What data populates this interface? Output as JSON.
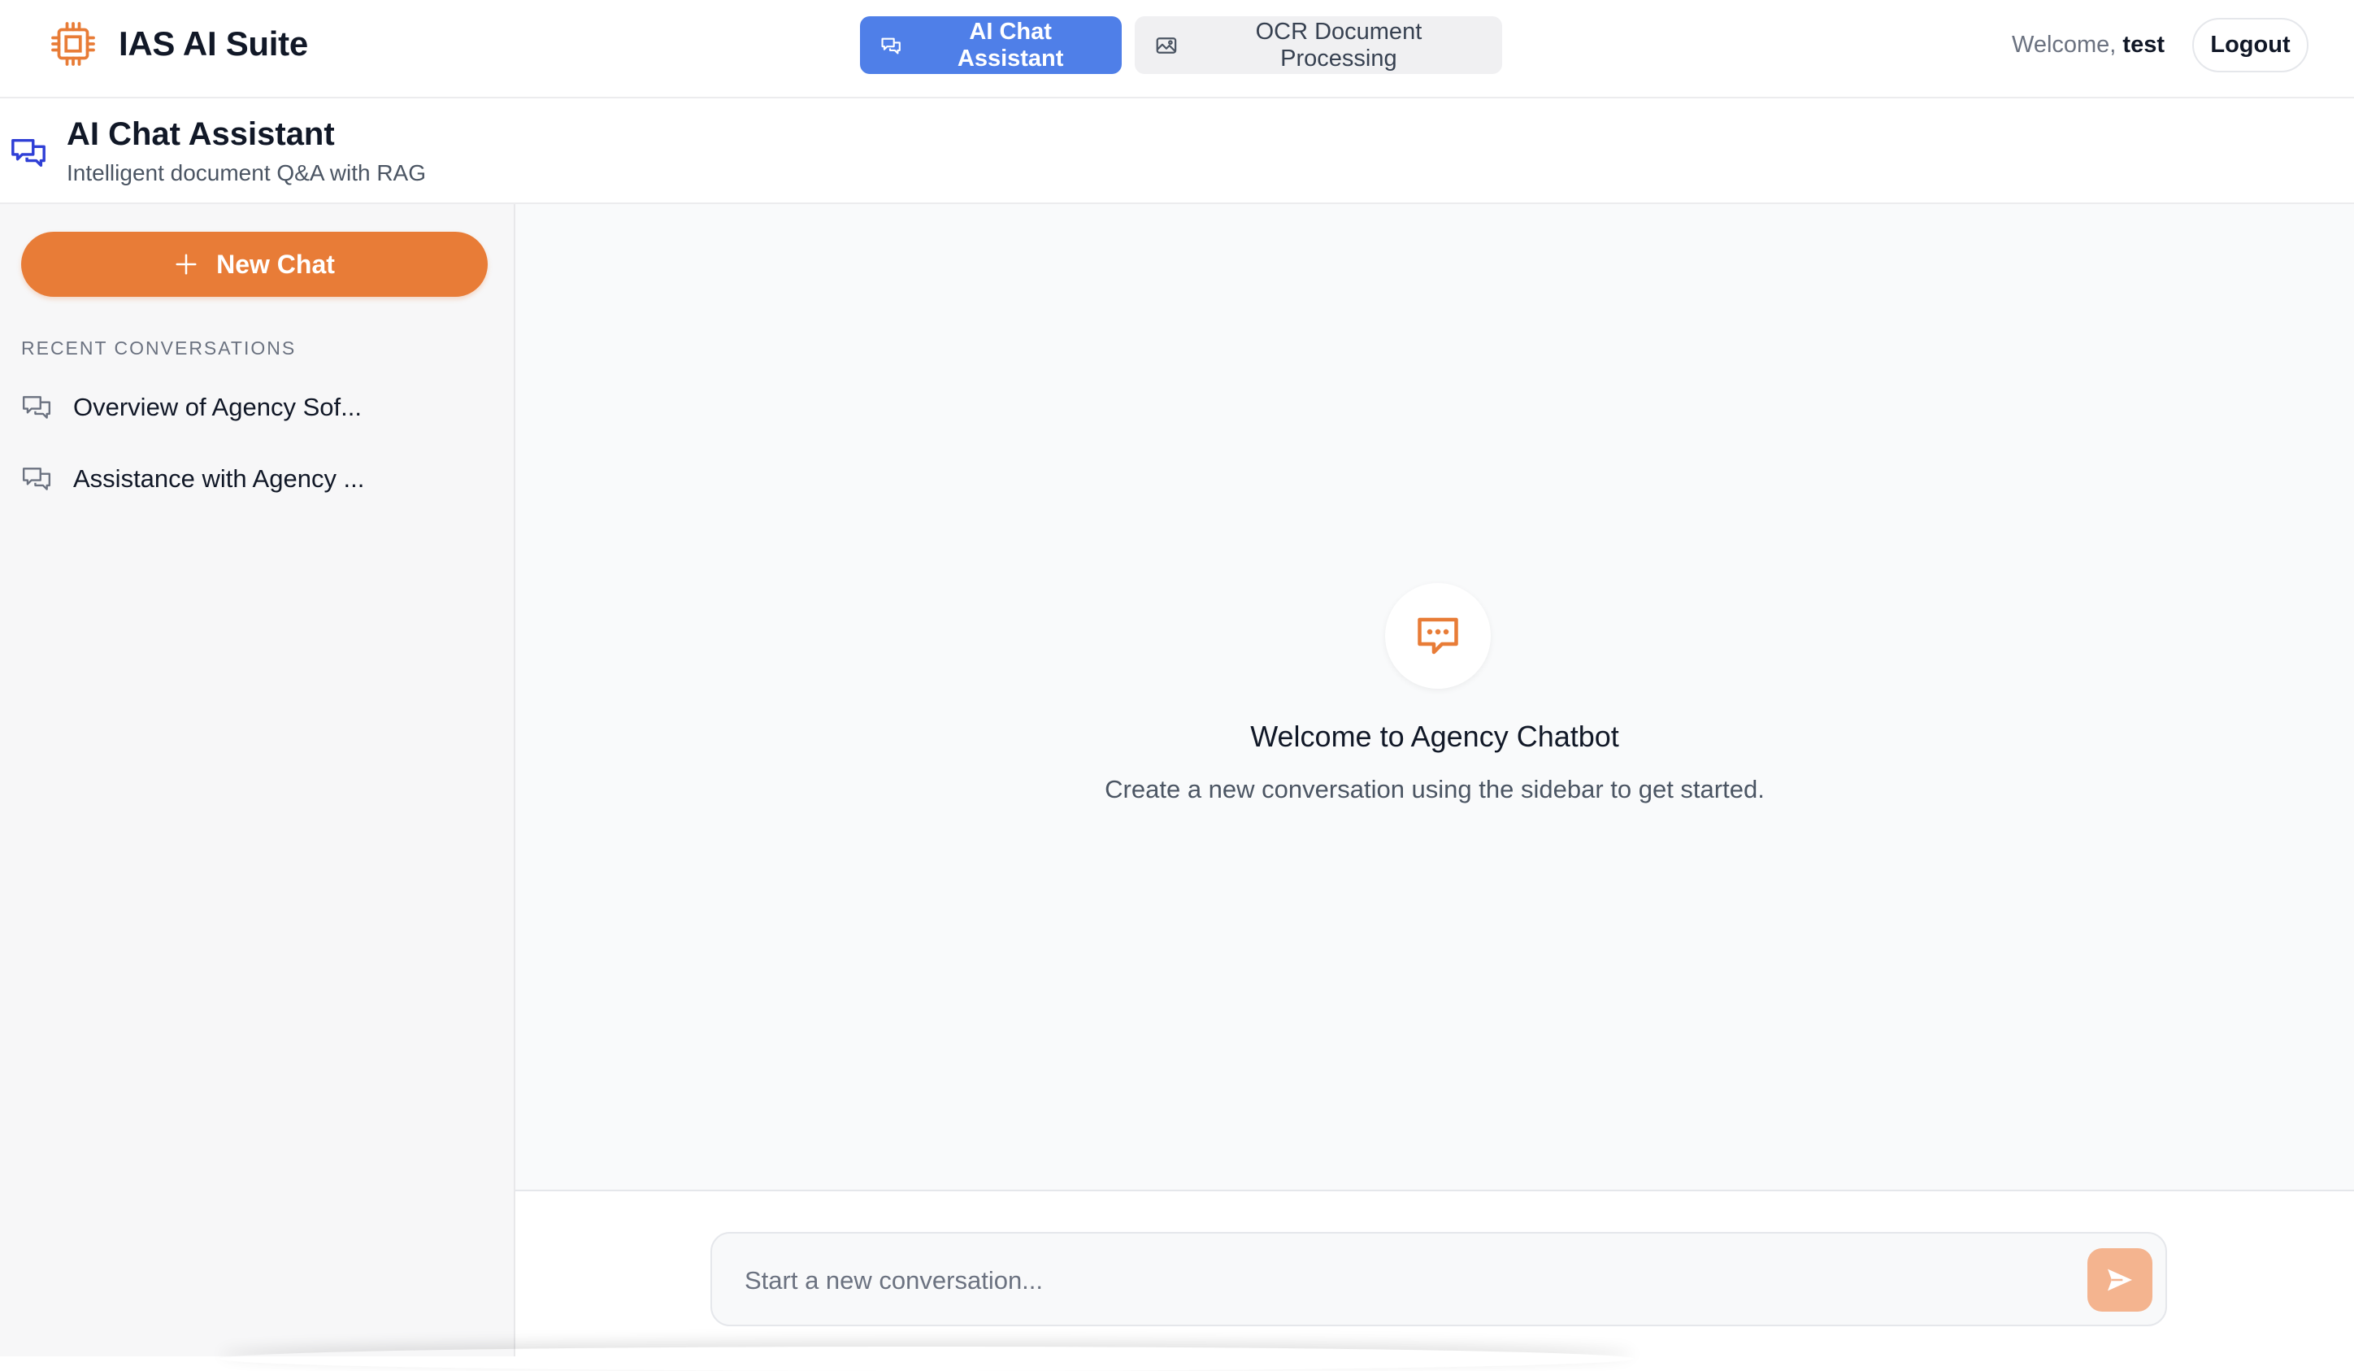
{
  "app": {
    "title": "IAS AI Suite",
    "brand_icon": "cpu-chip-icon",
    "accent_color": "#e87c37",
    "primary_color": "#4f7fe8"
  },
  "nav": {
    "tabs": [
      {
        "label": "AI Chat Assistant",
        "icon": "chat-bubbles-icon",
        "active": true
      },
      {
        "label": "OCR Document Processing",
        "icon": "image-icon",
        "active": false
      }
    ]
  },
  "user": {
    "welcome_prefix": "Welcome,",
    "username": "test",
    "logout_label": "Logout"
  },
  "page_header": {
    "title": "AI Chat Assistant",
    "subtitle": "Intelligent document Q&A with RAG",
    "icon": "chat-bubbles-icon"
  },
  "sidebar": {
    "new_chat_label": "New Chat",
    "recent_label": "Recent Conversations",
    "conversations": [
      {
        "title": "Overview of Agency Sof..."
      },
      {
        "title": "Assistance with Agency ..."
      }
    ]
  },
  "main": {
    "welcome_title": "Welcome to Agency Chatbot",
    "welcome_subtitle": "Create a new conversation using the sidebar to get started.",
    "welcome_icon": "message-dots-icon"
  },
  "composer": {
    "placeholder": "Start a new conversation...",
    "value": "",
    "send_icon": "send-icon"
  }
}
